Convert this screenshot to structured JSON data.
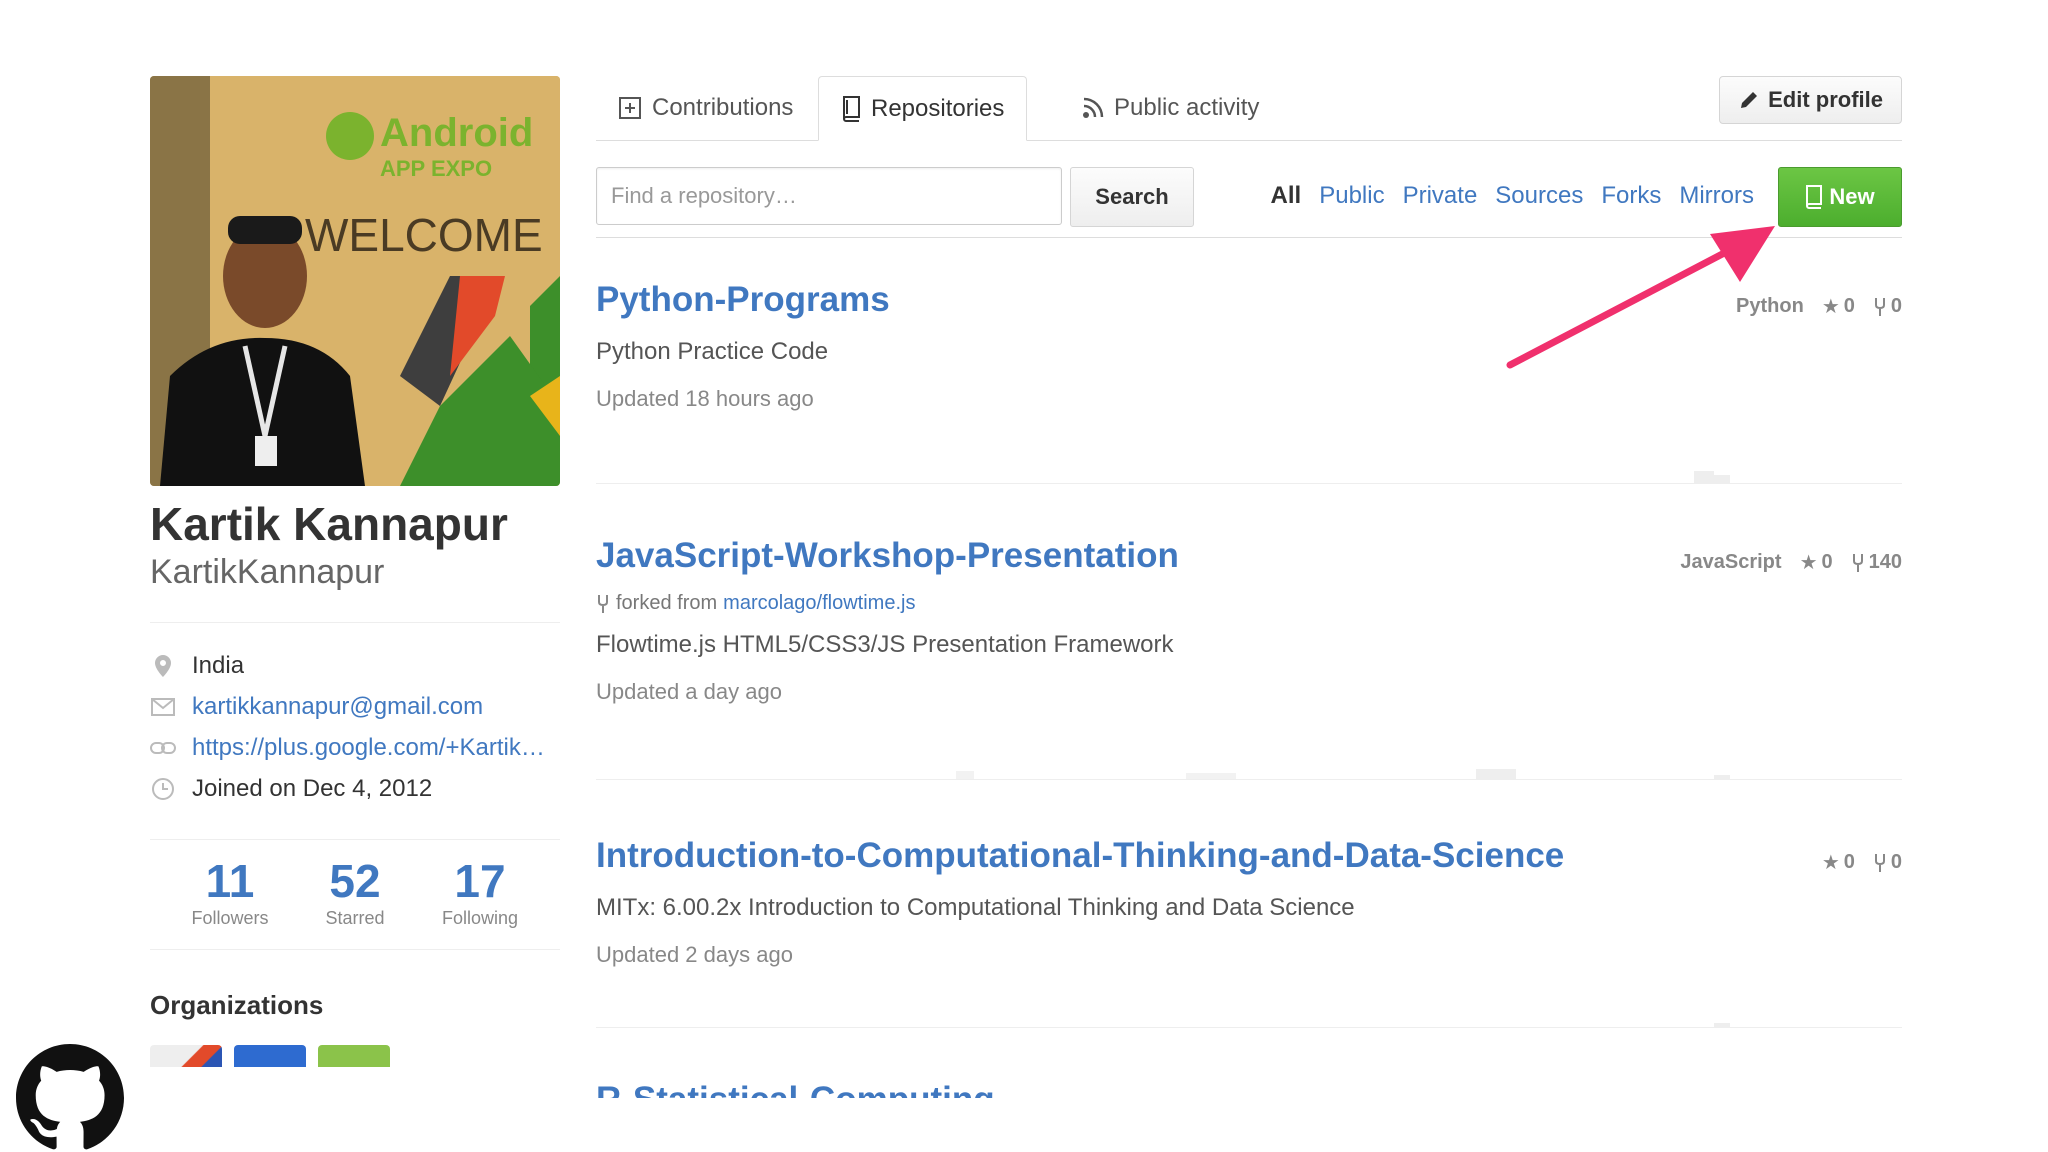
{
  "profile": {
    "full_name": "Kartik Kannapur",
    "username": "KartikKannapur",
    "avatar_banner": {
      "logo_line1": "Android",
      "logo_line2": "APP EXPO",
      "welcome": "WELCOME"
    },
    "location": "India",
    "email": "kartikkannapur@gmail.com",
    "website": "https://plus.google.com/+KartikKannapur",
    "joined": "Joined on Dec 4, 2012",
    "stats": [
      {
        "value": "11",
        "label": "Followers"
      },
      {
        "value": "52",
        "label": "Starred"
      },
      {
        "value": "17",
        "label": "Following"
      }
    ],
    "organizations_title": "Organizations"
  },
  "tabs": {
    "contributions": "Contributions",
    "repositories": "Repositories",
    "public_activity": "Public activity"
  },
  "edit_profile_label": "Edit profile",
  "repo_filter": {
    "search_placeholder": "Find a repository…",
    "search_label": "Search",
    "filters": [
      "All",
      "Public",
      "Private",
      "Sources",
      "Forks",
      "Mirrors"
    ],
    "active_filter": "All",
    "new_label": "New"
  },
  "repos": [
    {
      "name": "Python-Programs",
      "language": "Python",
      "stars": "0",
      "forks": "0",
      "description": "Python Practice Code",
      "updated": "Updated 18 hours ago"
    },
    {
      "name": "JavaScript-Workshop-Presentation",
      "language": "JavaScript",
      "stars": "0",
      "forks": "140",
      "forked_prefix": "forked from",
      "forked_from": "marcolago/flowtime.js",
      "description": "Flowtime.js HTML5/CSS3/JS Presentation Framework",
      "updated": "Updated a day ago"
    },
    {
      "name": "Introduction-to-Computational-Thinking-and-Data-Science",
      "stars": "0",
      "forks": "0",
      "description": "MITx: 6.00.2x Introduction to Computational Thinking and Data Science",
      "updated": "Updated 2 days ago"
    },
    {
      "name": "R-Statistical-Computing"
    }
  ],
  "colors": {
    "link": "#4078c0",
    "new_button": "#6cc644",
    "arrow": "#f0306d"
  },
  "icons": {
    "location": "location-pin-icon",
    "email": "mail-icon",
    "link": "link-icon",
    "joined": "clock-icon",
    "star": "star-icon",
    "fork": "fork-icon",
    "github": "github-octocat-icon"
  }
}
